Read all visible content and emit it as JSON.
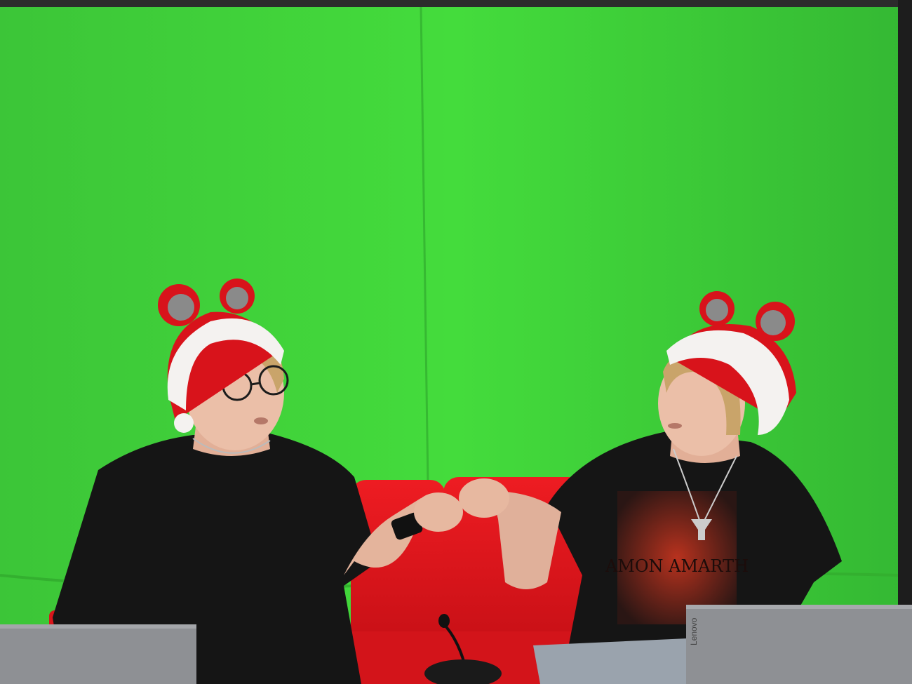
{
  "scene": {
    "description_free": true,
    "colors": {
      "green_screen": "#3fd33a",
      "green_screen_shadow": "#2aa82a",
      "sofa_red": "#e0141c",
      "hat_red": "#d8131b",
      "fur_white": "#f4f2f0",
      "ear_gray": "#8a8a8a",
      "shirt_black": "#151515",
      "skin": "#e7b8a0",
      "hair_blond": "#c9a46a",
      "laptop_gray": "#8e9094",
      "jeans": "#9aa3ad",
      "shirt_print_red": "#8b1a14"
    }
  },
  "laptop_right": {
    "brand": "Lenovo"
  },
  "shirt_right": {
    "print_text": "AMON AMARTH"
  }
}
